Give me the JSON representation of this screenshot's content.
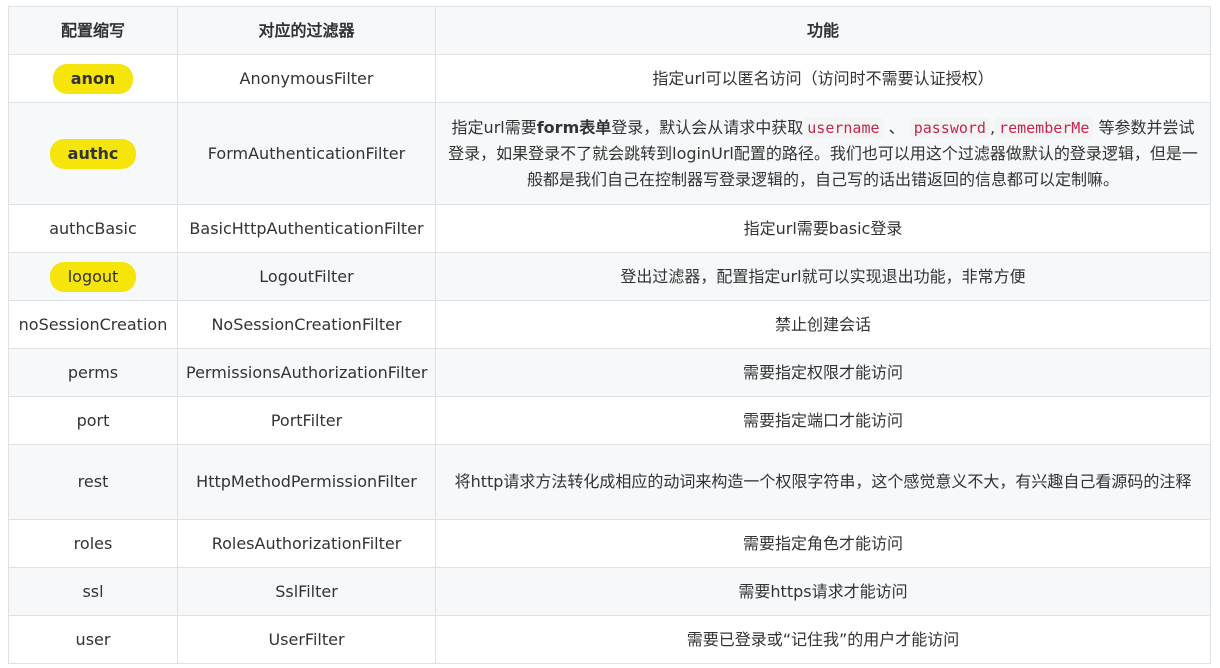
{
  "headers": [
    "配置缩写",
    "对应的过滤器",
    "功能"
  ],
  "rows": [
    {
      "abbr": "anon",
      "filter": "AnonymousFilter",
      "desc": "指定url可以匿名访问（访问时不需要认证授权）"
    },
    {
      "abbr": "authc",
      "filter": "FormAuthenticationFilter",
      "desc_parts": {
        "p1": "指定url需要",
        "bold": "form表单",
        "p2": "登录，默认会从请求中获取",
        "code1": "username",
        "sep1": " 、 ",
        "code2": "password",
        "sep2": ",",
        "code3": "rememberMe",
        "p3": " 等参数并尝试登录，如果登录不了就会跳转到loginUrl配置的路径。我们也可以用这个过滤器做默认的登录逻辑，但是一般都是我们自己在控制器写登录逻辑的，自己写的话出错返回的信息都可以定制嘛。"
      }
    },
    {
      "abbr": "authcBasic",
      "filter": "BasicHttpAuthenticationFilter",
      "desc": "指定url需要basic登录"
    },
    {
      "abbr": "logout",
      "filter": "LogoutFilter",
      "desc": "登出过滤器，配置指定url就可以实现退出功能，非常方便"
    },
    {
      "abbr": "noSessionCreation",
      "filter": "NoSessionCreationFilter",
      "desc": "禁止创建会话"
    },
    {
      "abbr": "perms",
      "filter": "PermissionsAuthorizationFilter",
      "desc": "需要指定权限才能访问"
    },
    {
      "abbr": "port",
      "filter": "PortFilter",
      "desc": "需要指定端口才能访问"
    },
    {
      "abbr": "rest",
      "filter": "HttpMethodPermissionFilter",
      "desc": "将http请求方法转化成相应的动词来构造一个权限字符串，这个感觉意义不大，有兴趣自己看源码的注释"
    },
    {
      "abbr": "roles",
      "filter": "RolesAuthorizationFilter",
      "desc": "需要指定角色才能访问"
    },
    {
      "abbr": "ssl",
      "filter": "SslFilter",
      "desc": "需要https请求才能访问"
    },
    {
      "abbr": "user",
      "filter": "UserFilter",
      "desc": "需要已登录或“记住我”的用户才能访问"
    }
  ],
  "highlight_color": "#f5e50b"
}
